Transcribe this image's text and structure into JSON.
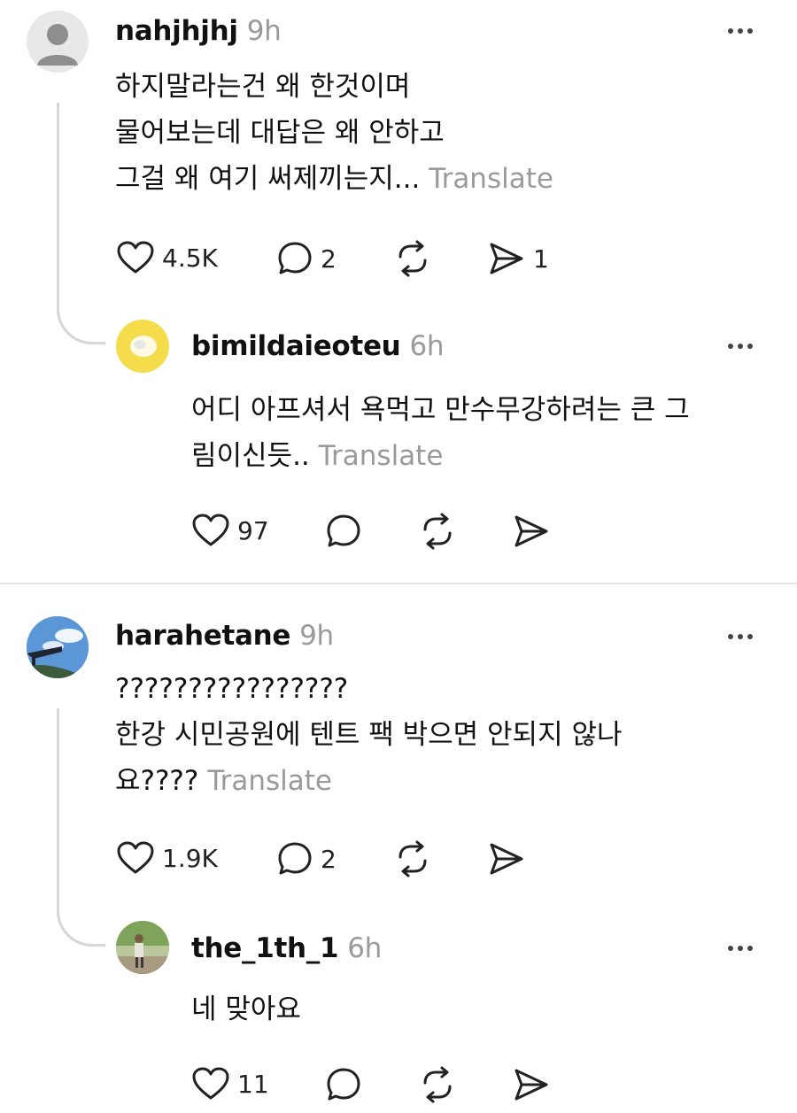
{
  "comments": [
    {
      "username": "nahjhjhj",
      "time": "9h",
      "lines": [
        "하지말라는건 왜 한것이며",
        "물어보는데 대답은 왜 안하고",
        "그걸 왜 여기 써제끼는지..."
      ],
      "translate": "Translate",
      "likes": "4.5K",
      "replies": "2",
      "shares": "1",
      "reply": {
        "username": "bimildaieoteu",
        "time": "6h",
        "lines": [
          "어디 아프셔서 욕먹고 만수무강하려는 큰 그",
          "림이신듯.."
        ],
        "translate": "Translate",
        "likes": "97"
      }
    },
    {
      "username": "harahetane",
      "time": "9h",
      "lines": [
        "????????????????",
        "한강 시민공원에 텐트 팩 박으면 안되지 않나",
        "요????"
      ],
      "translate": "Translate",
      "likes": "1.9K",
      "replies": "2",
      "reply": {
        "username": "the_1th_1",
        "time": "6h",
        "lines": [
          "네 맞아요"
        ],
        "likes": "11"
      }
    }
  ],
  "icons": {
    "like": "heart-icon",
    "comment": "comment-bubble-icon",
    "repost": "repost-icon",
    "share": "send-icon",
    "more": "more-dots-icon"
  },
  "colors": {
    "text": "#111111",
    "muted": "#9a9a9a",
    "thread_line": "#d6d6d6",
    "avatar_yellow": "#f5dc4a"
  }
}
